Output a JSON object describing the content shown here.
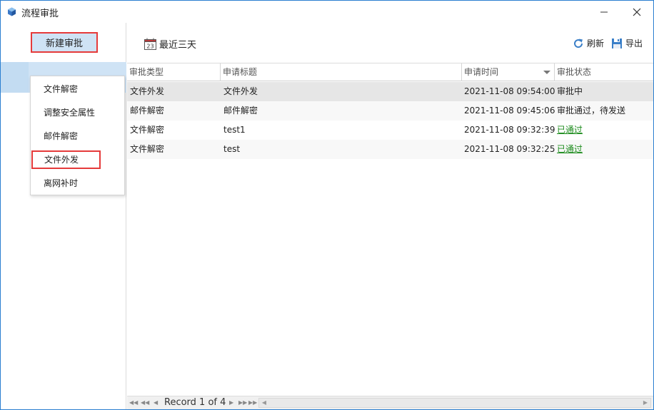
{
  "window": {
    "title": "流程审批",
    "minimize_glyph": "—",
    "close_glyph": "✕"
  },
  "sidebar": {
    "new_button_label": "新建审批",
    "menu_items": [
      {
        "label": "文件解密"
      },
      {
        "label": "调整安全属性"
      },
      {
        "label": "邮件解密"
      },
      {
        "label": "文件外发"
      },
      {
        "label": "离网补时"
      }
    ]
  },
  "toolbar": {
    "recent_label": "最近三天",
    "calendar_day": "23",
    "refresh_label": "刷新",
    "export_label": "导出"
  },
  "table": {
    "columns": [
      "审批类型",
      "申请标题",
      "申请时间",
      "审批状态"
    ],
    "rows": [
      {
        "type": "文件外发",
        "title": "文件外发",
        "time": "2021-11-08 09:54:00",
        "status": "审批中"
      },
      {
        "type": "邮件解密",
        "title": "邮件解密",
        "time": "2021-11-08 09:45:06",
        "status": "审批通过，待发送"
      },
      {
        "type": "文件解密",
        "title": "test1",
        "time": "2021-11-08 09:32:39",
        "status": "已通过"
      },
      {
        "type": "文件解密",
        "title": "test",
        "time": "2021-11-08 09:32:25",
        "status": "已通过"
      }
    ]
  },
  "footer": {
    "record_text": "Record 1 of 4"
  },
  "colors": {
    "accent": "#2b7fd0",
    "highlight_border": "#e53a3a",
    "status_ok": "#1a8a1a",
    "selected_row": "#e6e6e6"
  }
}
